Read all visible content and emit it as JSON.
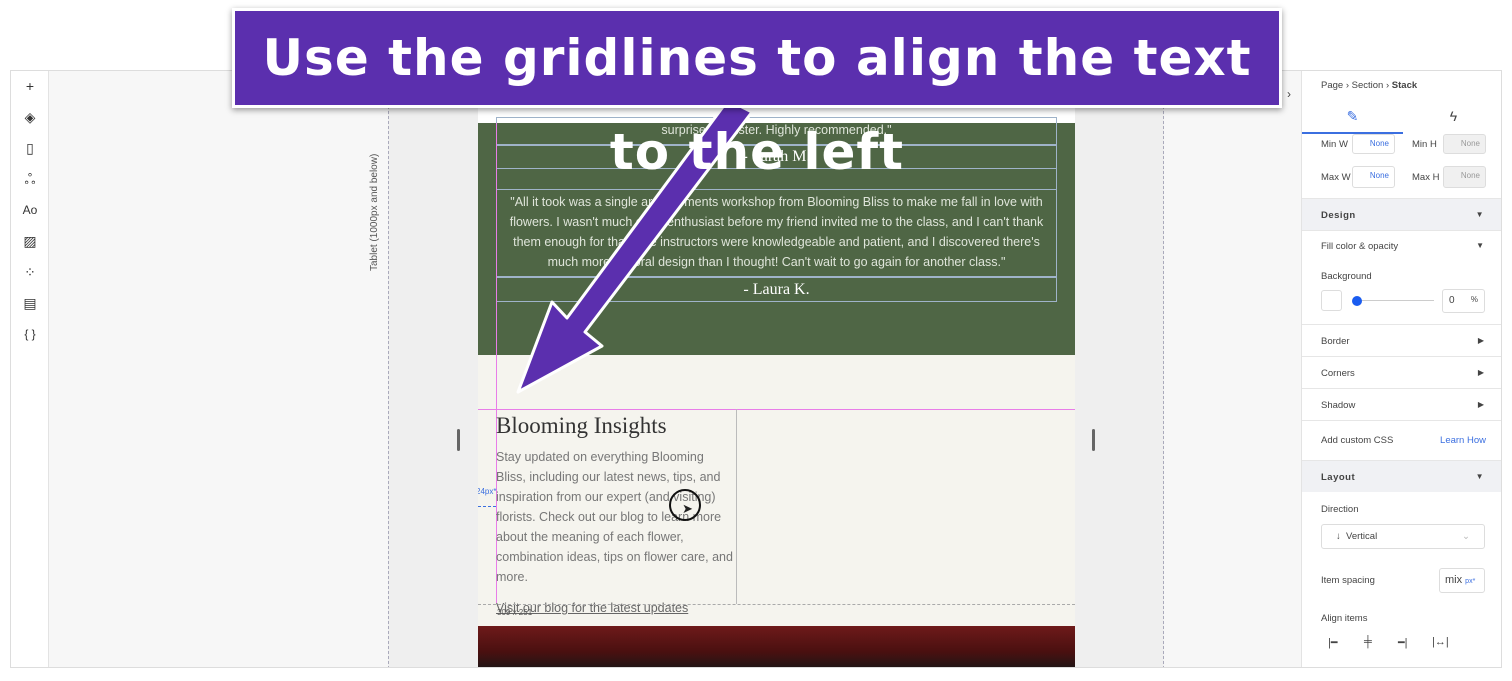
{
  "banner": {
    "text": "Use the gridlines to align the text to the left"
  },
  "toolbar": {
    "items": [
      "add-icon",
      "layers-icon",
      "pages-icon",
      "components-icon",
      "theme-icon",
      "media-icon",
      "apps-icon",
      "cms-icon",
      "code-icon"
    ]
  },
  "canvas": {
    "device_label": "Tablet (1000px and below)",
    "spacing_label": "24px*",
    "size_label": "309 x 251"
  },
  "testimonials": {
    "quote1_tail": "surprise my sister. Highly recommended.\"",
    "name1": "- Sarah M.",
    "quote2": "\"All it took was a single arrangements workshop from Blooming Bliss to make me fall in love with flowers. I wasn't much of an enthusiast before my friend invited me to the class, and I can't thank them enough for that. The instructors were knowledgeable and patient, and I discovered there's much more to floral design than I thought! Can't wait to go again for another class.\"",
    "name2": "- Laura K."
  },
  "blog": {
    "title": "Blooming Insights",
    "body": "Stay updated on everything Blooming Bliss, including our latest news, tips, and inspiration from our expert (and visiting) florists. Check out our blog to learn more about the meaning of each flower, combination ideas, tips on flower care, and more.",
    "link": "Visit our blog for the latest updates "
  },
  "panel": {
    "breadcrumb": [
      "Page",
      "Section",
      "Stack"
    ],
    "min_w_label": "Min W",
    "min_w": "None",
    "min_h_label": "Min H",
    "min_h": "None",
    "max_w_label": "Max W",
    "max_w": "None",
    "max_h_label": "Max H",
    "max_h": "None",
    "design": "Design",
    "fill": "Fill color & opacity",
    "background": "Background",
    "opacity": "0",
    "opacity_unit": "%",
    "opacity_value": 0,
    "border": "Border",
    "corners": "Corners",
    "shadow": "Shadow",
    "custom_css": "Add custom CSS",
    "learn_how": "Learn How",
    "layout": "Layout",
    "direction_label": "Direction",
    "direction": "Vertical",
    "spacing_label": "Item spacing",
    "spacing": "mix",
    "spacing_unit": "px*",
    "align_label": "Align items"
  },
  "colors": {
    "accent": "#3b6fe0",
    "banner": "#5b2fae",
    "green": "#4f6645",
    "guide": "#e87de8"
  }
}
